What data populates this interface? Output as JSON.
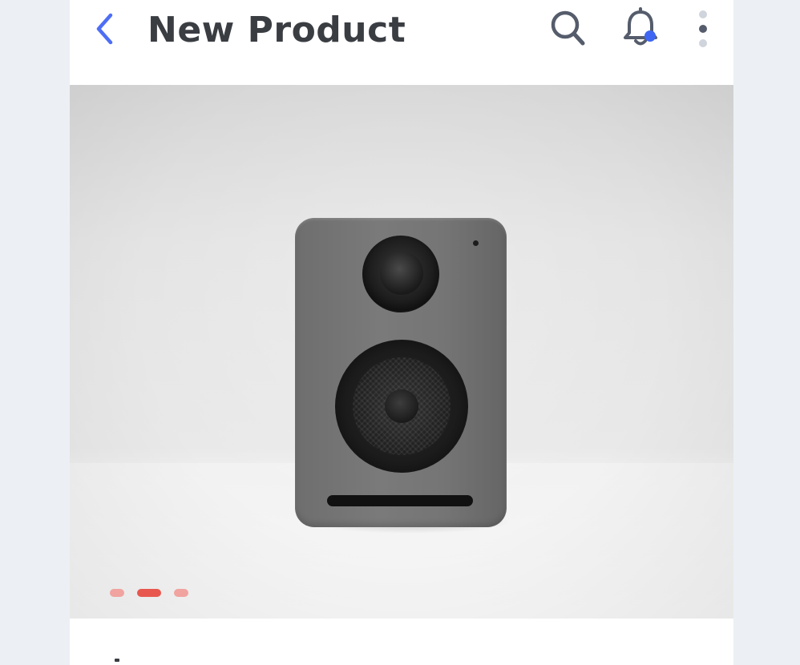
{
  "header": {
    "title": "New Product",
    "back_icon": "chevron-left-icon",
    "search_icon": "search-icon",
    "notification_icon": "bell-icon",
    "more_icon": "more-vertical-icon"
  },
  "hero": {
    "image_subject": "speaker",
    "carousel": {
      "total_slides": 3,
      "active_index": 1
    }
  },
  "colors": {
    "accent": "#4d6ef5",
    "title_text": "#3a3d42",
    "icon_gray": "#555c6b",
    "dot_inactive": "#f0a39f",
    "dot_active": "#e8574e",
    "notification_badge": "#3f66f2",
    "app_background": "#eceff4"
  }
}
